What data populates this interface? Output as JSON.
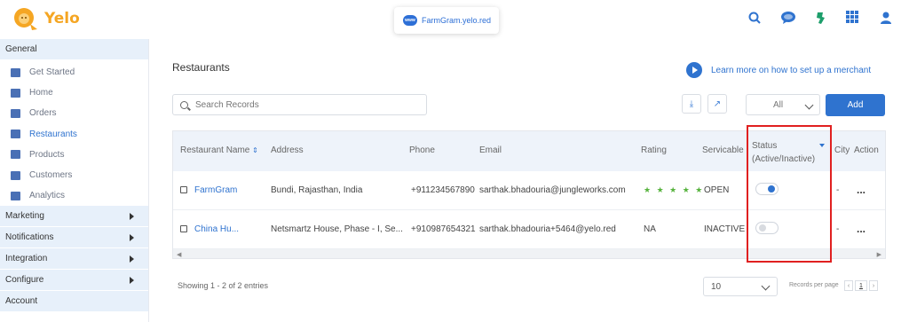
{
  "app": {
    "brand": "Yelo",
    "url": "FarmGram.yelo.red",
    "url_badge": "www"
  },
  "topbar_icons": [
    "search-icon",
    "chat-icon",
    "puzzle-icon",
    "apps-grid-icon",
    "user-icon"
  ],
  "sidebar": {
    "general_label": "General",
    "items": [
      {
        "label": "Get Started",
        "icon": "checklist-icon"
      },
      {
        "label": "Home",
        "icon": "home-icon"
      },
      {
        "label": "Orders",
        "icon": "orders-icon"
      },
      {
        "label": "Restaurants",
        "icon": "restaurant-icon",
        "active": true
      },
      {
        "label": "Products",
        "icon": "products-icon"
      },
      {
        "label": "Customers",
        "icon": "customers-icon"
      },
      {
        "label": "Analytics",
        "icon": "analytics-icon"
      }
    ],
    "sections": [
      {
        "label": "Marketing"
      },
      {
        "label": "Notifications"
      },
      {
        "label": "Integration"
      },
      {
        "label": "Configure"
      },
      {
        "label": "Account"
      }
    ]
  },
  "main": {
    "title": "Restaurants",
    "learn_more": "Learn more on how to set up a merchant",
    "search_placeholder": "Search Records",
    "filter_value": "All",
    "add_label": "Add",
    "columns": {
      "restaurant_name": "Restaurant Name",
      "address": "Address",
      "phone": "Phone",
      "email": "Email",
      "rating": "Rating",
      "servicable": "Servicable",
      "status_line1": "Status",
      "status_line2": "(Active/Inactive)",
      "city": "City",
      "action": "Action"
    },
    "rows": [
      {
        "name": "FarmGram",
        "address": "Bundi, Rajasthan, India",
        "phone": "+911234567890",
        "email": "sarthak.bhadouria@jungleworks.com",
        "rating": "★ ★ ★ ★ ★",
        "servicable": "OPEN",
        "status_active": true,
        "city": "-",
        "action": "..."
      },
      {
        "name": "China Hu...",
        "address": "Netsmartz House, Phase - I, Se...",
        "phone": "+910987654321",
        "email": "sarthak.bhadouria+5464@yelo.red",
        "rating": "NA",
        "servicable": "INACTIVE",
        "status_active": false,
        "city": "-",
        "action": "..."
      }
    ],
    "footer": {
      "showing": "Showing 1 - 2 of 2 entries",
      "per_page_value": "10",
      "records_per_page": "Records per page",
      "current_page": "1",
      "prev": "‹",
      "next": "›"
    }
  }
}
